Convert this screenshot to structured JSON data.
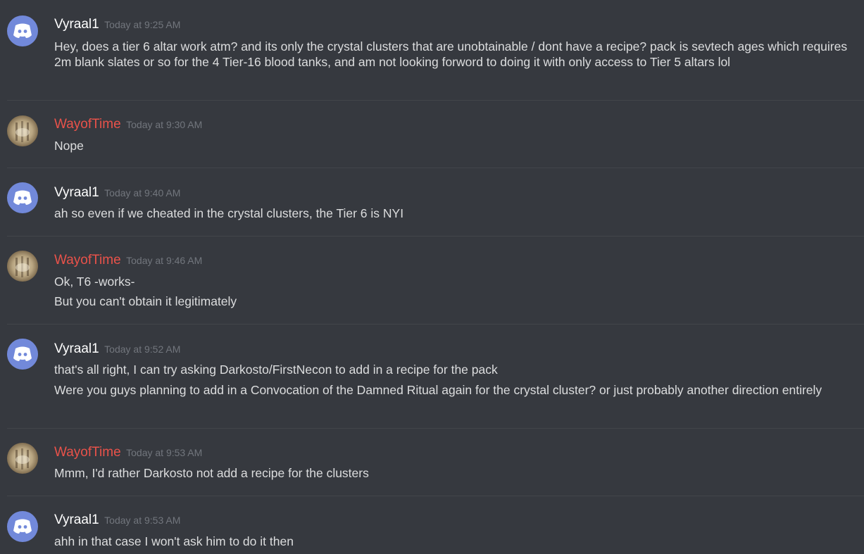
{
  "messages": [
    {
      "author": "Vyraal1",
      "timestamp": "Today at 9:25 AM",
      "avatar": "discord-logo-icon",
      "color": "#ffffff",
      "lines": [
        "Hey, does a tier 6 altar work atm? and its only the crystal clusters that are unobtainable / dont have a recipe? pack is sevtech ages which requires 2m blank slates or so for the 4 Tier-16 blood tanks, and am not looking forword to doing it with only access to Tier 5 altars lol"
      ]
    },
    {
      "author": "WayofTime",
      "timestamp": "Today at 9:30 AM",
      "avatar": "user-photo-avatar",
      "color": "#e9524a",
      "lines": [
        "Nope"
      ]
    },
    {
      "author": "Vyraal1",
      "timestamp": "Today at 9:40 AM",
      "avatar": "discord-logo-icon",
      "color": "#ffffff",
      "lines": [
        "ah so even if we cheated in the crystal clusters, the Tier 6 is NYI"
      ]
    },
    {
      "author": "WayofTime",
      "timestamp": "Today at 9:46 AM",
      "avatar": "user-photo-avatar",
      "color": "#e9524a",
      "lines": [
        "Ok, T6 -works-",
        "But you can't obtain it legitimately"
      ]
    },
    {
      "author": "Vyraal1",
      "timestamp": "Today at 9:52 AM",
      "avatar": "discord-logo-icon",
      "color": "#ffffff",
      "lines": [
        "that's all right, I can try asking Darkosto/FirstNecon to add in a recipe for the pack",
        "Were you guys planning to add in a Convocation of the Damned Ritual again for the crystal cluster? or just probably another direction entirely"
      ]
    },
    {
      "author": "WayofTime",
      "timestamp": "Today at 9:53 AM",
      "avatar": "user-photo-avatar",
      "color": "#e9524a",
      "lines": [
        "Mmm, I'd rather Darkosto not add a recipe for the clusters"
      ]
    },
    {
      "author": "Vyraal1",
      "timestamp": "Today at 9:53 AM",
      "avatar": "discord-logo-icon",
      "color": "#ffffff",
      "lines": [
        "ahh in that case I won't ask him to do it then"
      ]
    }
  ]
}
